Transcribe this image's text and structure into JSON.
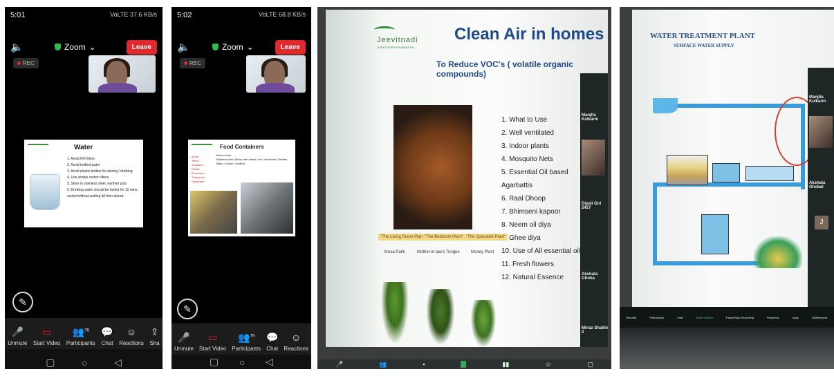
{
  "panel1": {
    "time": "5:01",
    "status_right": "VoLTE 37.6 KB/s",
    "meeting_title": "Zoom",
    "leave_label": "Leave",
    "rec_label": "REC",
    "slide_title": "Water",
    "slide_items": [
      "1.  Avoid RO filters",
      "2.  Avoid bottled water",
      "3.  Avoid plastic bottles for storing / drinking",
      "4.  Use simple carbon filters",
      "5.  Store in stainless steel, earthen pots",
      "6.  Drinking water should be boiled for 10 mins, cooled without putting lid then stored."
    ]
  },
  "panel2": {
    "time": "5:02",
    "status_right": "VoLTE 68.8 KB/s",
    "meeting_title": "Zoom",
    "leave_label": "Leave",
    "rec_label": "REC",
    "slide_title": "Food Containers",
    "slide_left_list": [
      "Avoid",
      "Teflon",
      "Anodised",
      "Plastic",
      "Aluminium",
      "Thermocol",
      "Styrofoam"
    ],
    "slide_body": "What to Use\nStainless steel, Brass with kalhai, Iron, Hindalium, Earthen, Glass, Copper, Ceramic"
  },
  "toolbar": {
    "unmute": "Unmute",
    "start_video": "Start Video",
    "participants": "Participants",
    "participants_count": "76",
    "chat": "Chat",
    "reactions": "Reactions",
    "share": "Sha"
  },
  "panel3": {
    "logo_text": "Jeevitnadi",
    "logo_sub": "LIVING RIVER FOUNDATION",
    "title": "Clean Air in homes",
    "subtitle": "To Reduce VOC's ( volatile organic compounds)",
    "items": [
      "1.   What to Use",
      "2.   Well ventilated",
      "3.   Indoor plants",
      "4.   Mosquito Nets",
      "5.   Essential Oil based",
      "      Agarbattis",
      "6.   Raal Dhoop",
      "7.   Bhimseni kapoor",
      "8.   Neem oil diya",
      "9.   Ghee diya",
      "10. Use of All essential oils",
      "11. Fresh flowers",
      "12. Natural Essence"
    ],
    "plant_chips": [
      "\"The Living Room Plant\"",
      "\"The Bedroom Plant\"",
      "\"The Specialist Plant\""
    ],
    "plant_names": [
      "Areca Palm",
      "Mother-in-law's Tongue",
      "Money Plant"
    ],
    "side_names": [
      "Manjita Kulkarni",
      "Dipali Giri 2427",
      "Akshata Ghoba",
      "Minaz Shaikh 2"
    ]
  },
  "panel4": {
    "title": "WATER TREATMENT PLANT",
    "subtitle": "SURFACE WATER SUPPLY",
    "side_names": [
      "Manjita Kulkarni",
      "Akshata Ghobal"
    ],
    "taskbar": [
      "Security",
      "Participants",
      "Chat",
      "Share Screen",
      "Pause/Stop Recording",
      "Reactions",
      "Apps",
      "Whiteboards"
    ]
  }
}
